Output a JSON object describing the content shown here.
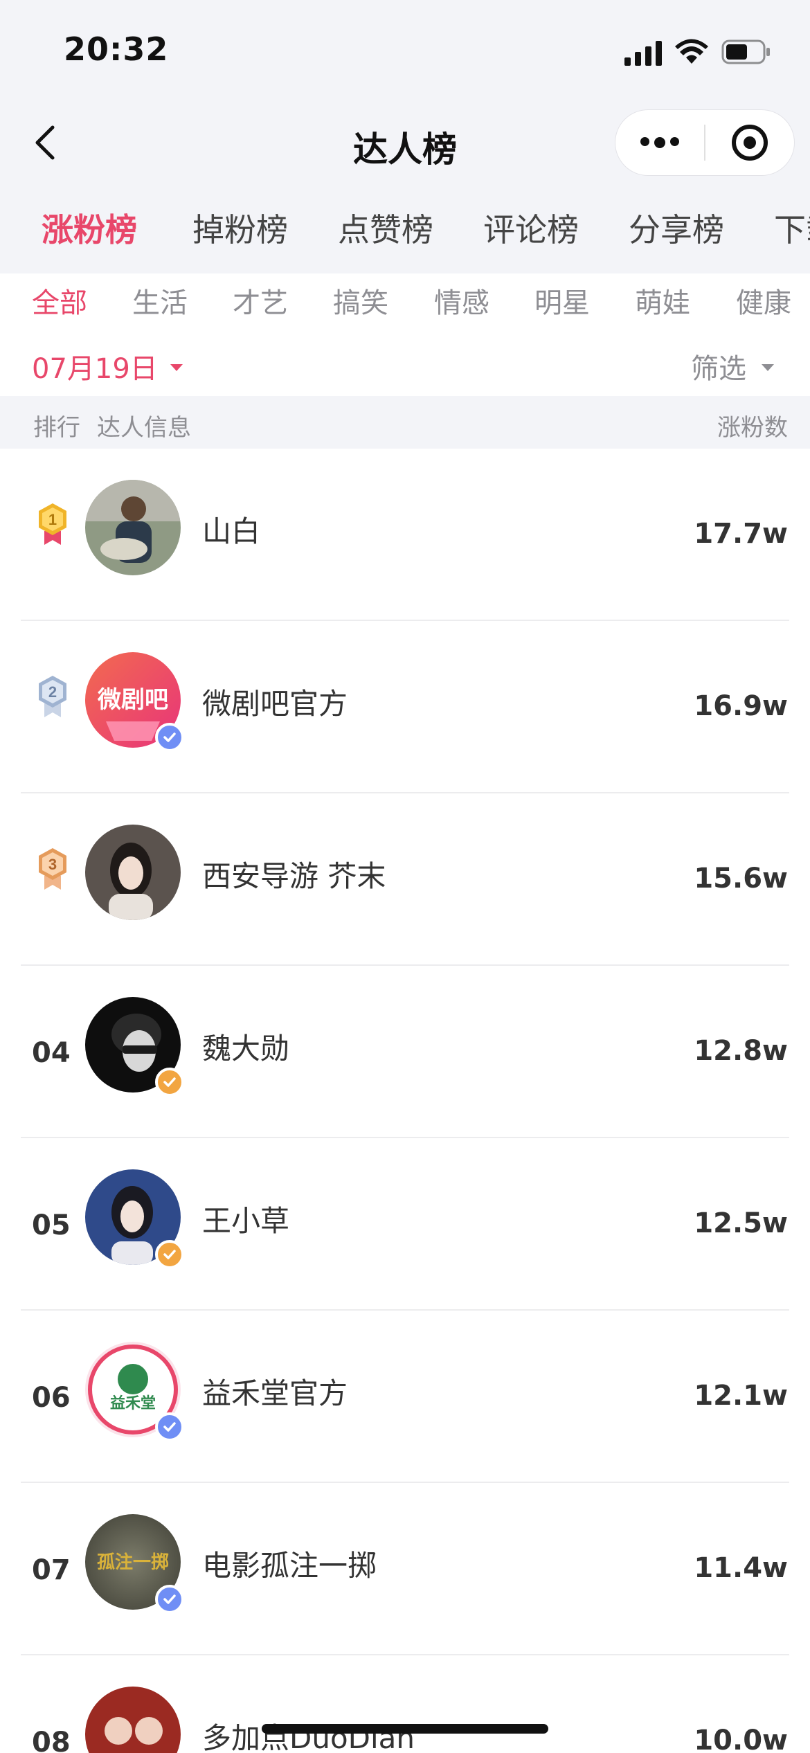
{
  "status_bar": {
    "time": "20:32"
  },
  "nav": {
    "title": "达人榜"
  },
  "main_tabs": [
    {
      "label": "涨粉榜",
      "active": true
    },
    {
      "label": "掉粉榜",
      "active": false
    },
    {
      "label": "点赞榜",
      "active": false
    },
    {
      "label": "评论榜",
      "active": false
    },
    {
      "label": "分享榜",
      "active": false
    },
    {
      "label": "下载榜",
      "active": false
    }
  ],
  "sub_tabs": [
    {
      "label": "全部",
      "active": true
    },
    {
      "label": "生活",
      "active": false
    },
    {
      "label": "才艺",
      "active": false
    },
    {
      "label": "搞笑",
      "active": false
    },
    {
      "label": "情感",
      "active": false
    },
    {
      "label": "明星",
      "active": false
    },
    {
      "label": "萌娃",
      "active": false
    },
    {
      "label": "健康",
      "active": false
    }
  ],
  "date_select": {
    "value": "07月19日"
  },
  "filter": {
    "label": "筛选"
  },
  "list_header": {
    "rank": "排行",
    "info": "达人信息",
    "fans": "涨粉数"
  },
  "colors": {
    "accent": "#e8476a",
    "gold": "#f0b429",
    "silver": "#9fb3d1",
    "bronze": "#e59b5b",
    "verified_blue": "#6f8ef5",
    "verified_orange": "#f2a541"
  },
  "rows": [
    {
      "rank": "1",
      "medal": "gold",
      "name": "山白",
      "fans": "17.7w",
      "verified": ""
    },
    {
      "rank": "2",
      "medal": "silver",
      "name": "微剧吧官方",
      "fans": "16.9w",
      "verified": "blue",
      "avatar_text": "微剧吧"
    },
    {
      "rank": "3",
      "medal": "bronze",
      "name": "西安导游 芥末",
      "fans": "15.6w",
      "verified": ""
    },
    {
      "rank": "04",
      "medal": "",
      "name": "魏大勋",
      "fans": "12.8w",
      "verified": "orange"
    },
    {
      "rank": "05",
      "medal": "",
      "name": "王小草",
      "fans": "12.5w",
      "verified": "orange"
    },
    {
      "rank": "06",
      "medal": "",
      "name": "益禾堂官方",
      "fans": "12.1w",
      "verified": "blue",
      "avatar_text": "益禾堂"
    },
    {
      "rank": "07",
      "medal": "",
      "name": "电影孤注一掷",
      "fans": "11.4w",
      "verified": "blue",
      "avatar_text": "孤注一掷"
    },
    {
      "rank": "08",
      "medal": "",
      "name": "多加点DuoDian",
      "fans": "10.0w",
      "verified": ""
    }
  ]
}
